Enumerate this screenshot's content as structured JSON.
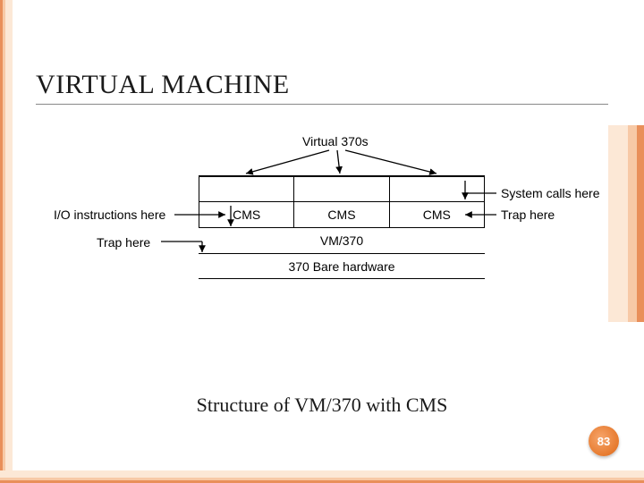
{
  "slide": {
    "title": "VIRTUAL MACHINE",
    "caption": "Structure of VM/370 with CMS",
    "page": "83"
  },
  "diagram": {
    "top_label": "Virtual 370s",
    "cms_row": [
      "CMS",
      "CMS",
      "CMS"
    ],
    "mid_row": "VM/370",
    "bottom_row": "370 Bare hardware",
    "left_labels": {
      "io": "I/O instructions here",
      "trap_left": "Trap here"
    },
    "right_labels": {
      "syscalls": "System calls here",
      "trap_right": "Trap here"
    }
  }
}
